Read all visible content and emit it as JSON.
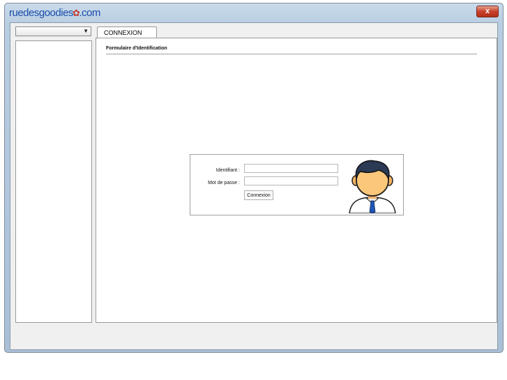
{
  "window": {
    "app_title_main": "ruedesgoodies",
    "app_title_domain": ".com",
    "close_label": "x"
  },
  "sidebar": {
    "dropdown_value": ""
  },
  "tabs": [
    {
      "label": "CONNEXION",
      "active": true
    }
  ],
  "main": {
    "form_title": "Formulaire d'Identification",
    "login": {
      "username_label": "Identifiant :",
      "username_value": "",
      "password_label": "Mot de passe :",
      "password_value": "",
      "submit_label": "Connexion"
    }
  },
  "colors": {
    "brand": "#1b4ea8",
    "window_frame": "#b9cde2",
    "close_button": "#c8412a"
  },
  "icons": {
    "logo_mark": "bee-icon",
    "user_avatar": "user-avatar-icon",
    "dropdown_arrow": "caret-down-icon"
  }
}
